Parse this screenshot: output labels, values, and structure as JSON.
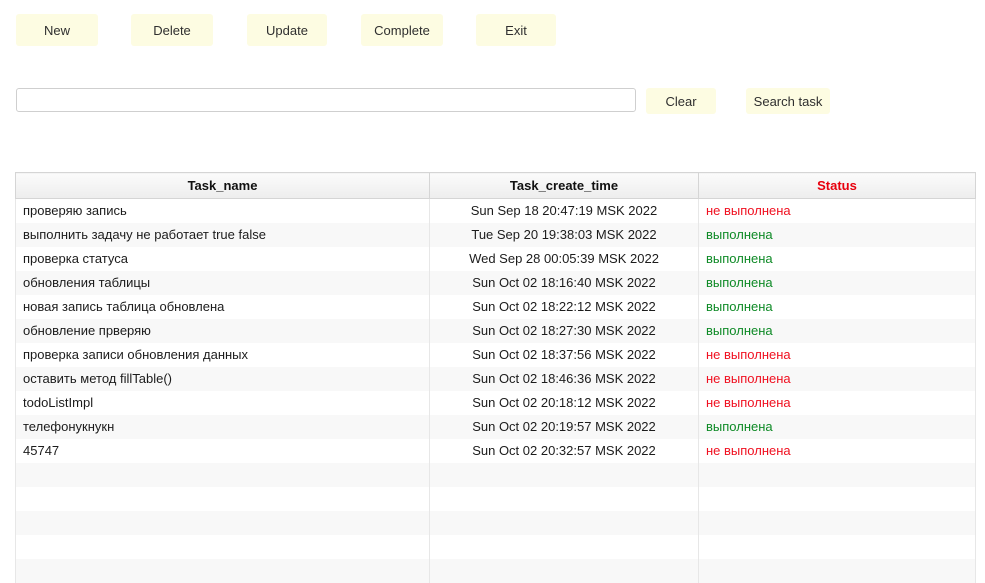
{
  "toolbar": {
    "new_label": "New",
    "delete_label": "Delete",
    "update_label": "Update",
    "complete_label": "Complete",
    "exit_label": "Exit"
  },
  "search": {
    "value": "",
    "placeholder": "",
    "clear_label": "Clear",
    "search_label": "Search task"
  },
  "table": {
    "headers": {
      "task_name": "Task_name",
      "task_create_time": "Task_create_time",
      "status": "Status"
    },
    "status_colors": {
      "done": "#0e8a26",
      "not_done": "#f01020",
      "header": "#e8000d"
    },
    "rows": [
      {
        "name": "проверяю запись",
        "time": "Sun Sep 18 20:47:19 MSK 2022",
        "status": "не выполнена",
        "done": false
      },
      {
        "name": " выполнить задачу не работает true false",
        "time": "Tue Sep 20 19:38:03 MSK 2022",
        "status": "выполнена",
        "done": true
      },
      {
        "name": "проверка статуса",
        "time": "Wed Sep 28 00:05:39 MSK 2022",
        "status": "выполнена",
        "done": true
      },
      {
        "name": "обновления таблицы",
        "time": "Sun Oct 02 18:16:40 MSK 2022",
        "status": "выполнена",
        "done": true
      },
      {
        "name": "новая запись таблица обновлена",
        "time": "Sun Oct 02 18:22:12 MSK 2022",
        "status": "выполнена",
        "done": true
      },
      {
        "name": "обновление прверяю",
        "time": "Sun Oct 02 18:27:30 MSK 2022",
        "status": "выполнена",
        "done": true
      },
      {
        "name": "проверка записи обновления данных",
        "time": "Sun Oct 02 18:37:56 MSK 2022",
        "status": "не выполнена",
        "done": false
      },
      {
        "name": "оставить метод fillTable()",
        "time": "Sun Oct 02 18:46:36 MSK 2022",
        "status": "не выполнена",
        "done": false
      },
      {
        "name": "todoListImpl",
        "time": "Sun Oct 02 20:18:12 MSK 2022",
        "status": "не выполнена",
        "done": false
      },
      {
        "name": "телефонукнукн",
        "time": "Sun Oct 02 20:19:57 MSK 2022",
        "status": "выполнена",
        "done": true
      },
      {
        "name": "45747",
        "time": "Sun Oct 02 20:32:57 MSK 2022",
        "status": "не выполнена",
        "done": false
      },
      {
        "name": "",
        "time": "",
        "status": "",
        "done": null
      },
      {
        "name": "",
        "time": "",
        "status": "",
        "done": null
      },
      {
        "name": "",
        "time": "",
        "status": "",
        "done": null
      },
      {
        "name": "",
        "time": "",
        "status": "",
        "done": null
      },
      {
        "name": "",
        "time": "",
        "status": "",
        "done": null
      }
    ]
  }
}
